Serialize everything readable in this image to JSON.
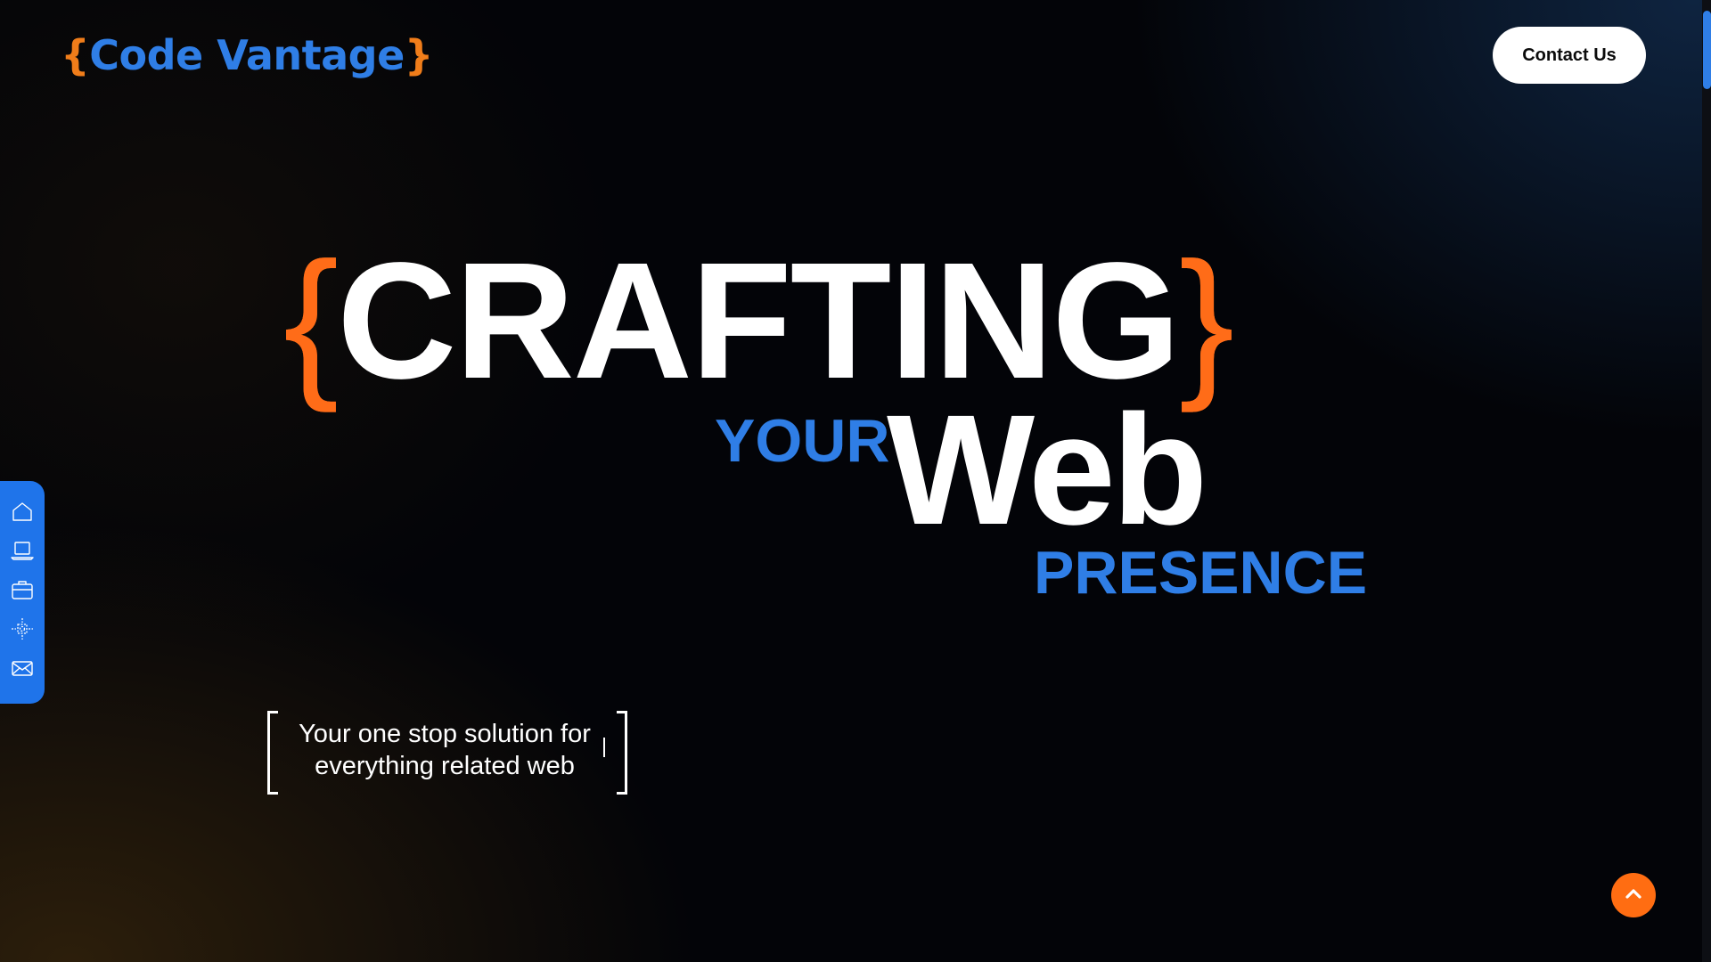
{
  "header": {
    "logo_open_brace": "{",
    "logo_text": "Code Vantage",
    "logo_close_brace": "}",
    "contact_label": "Contact Us"
  },
  "hero": {
    "open_brace": "{",
    "line1": "CRAFTING",
    "close_brace": "}",
    "your": "YOUR",
    "web": "Web",
    "presence": "PRESENCE",
    "tagline_line1": "Your one stop solution for",
    "tagline_line2": "everything related web"
  },
  "side_nav": {
    "items": [
      {
        "icon": "home-icon"
      },
      {
        "icon": "laptop-icon"
      },
      {
        "icon": "briefcase-icon"
      },
      {
        "icon": "settings-grid-icon"
      },
      {
        "icon": "mail-icon"
      }
    ]
  },
  "colors": {
    "accent_blue": "#2f7ee6",
    "accent_orange": "#ff6d12",
    "background": "#030408"
  }
}
